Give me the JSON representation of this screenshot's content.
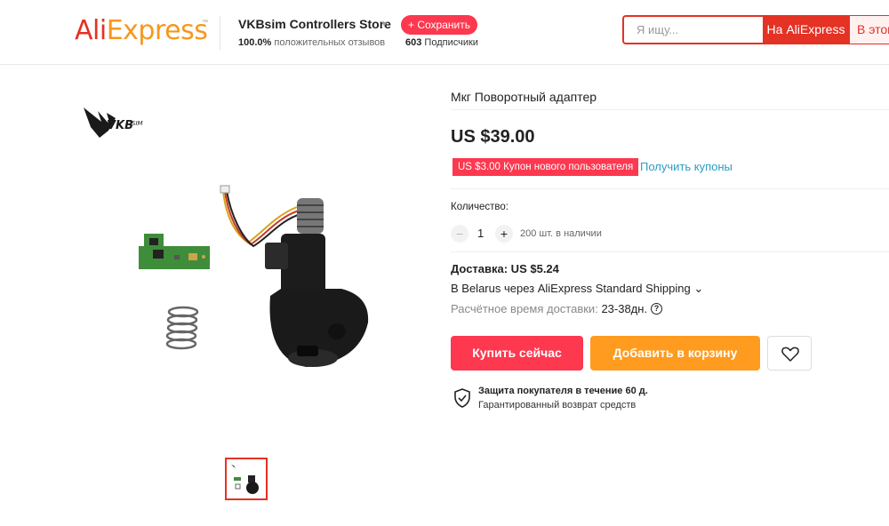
{
  "header": {
    "logo_primary": "Ali",
    "logo_secondary": "Express",
    "logo_tm": "™",
    "store_name": "VKBsim Controllers Store",
    "save_label": "+ Сохранить",
    "rating_value": "100.0%",
    "rating_label": "положительных отзывов",
    "subscribers_value": "603",
    "subscribers_label": "Подписчики",
    "search_placeholder": "Я ищу...",
    "search_ali_label": "На AliExpress",
    "search_store_label": "В этом магазине"
  },
  "gallery": {
    "brand_logo_text": "VKBsim"
  },
  "product": {
    "title": "Мкг Поворотный адаптер",
    "price": "US $39.00",
    "coupon_text": "US $3.00 Купон нового пользователя",
    "coupon_link": "Получить купоны",
    "quantity_label": "Количество:",
    "quantity_minus": "−",
    "quantity_plus": "+",
    "quantity_value": "1",
    "stock_text": "200 шт. в наличии",
    "shipping_title": "Доставка: US $5.24",
    "shipping_method": "В Belarus через AliExpress Standard Shipping ⌄",
    "delivery_time_label": "Расчётное время доставки:",
    "delivery_time_value": "23-38дн.",
    "help_glyph": "?",
    "buy_now_label": "Купить сейчас",
    "add_to_cart_label": "Добавить в корзину",
    "protection_title": "Защита покупателя в течение 60 д.",
    "protection_subtitle": "Гарантированный возврат средств"
  },
  "colors": {
    "brand_red": "#e43225",
    "brand_orange": "#f7971d",
    "buy_red": "#fd384f",
    "cart_orange": "#ff9b1f",
    "link_blue": "#2e9cc3"
  },
  "icons": [
    "caret-down-icon",
    "help-icon",
    "heart-icon",
    "shield-check-icon"
  ]
}
